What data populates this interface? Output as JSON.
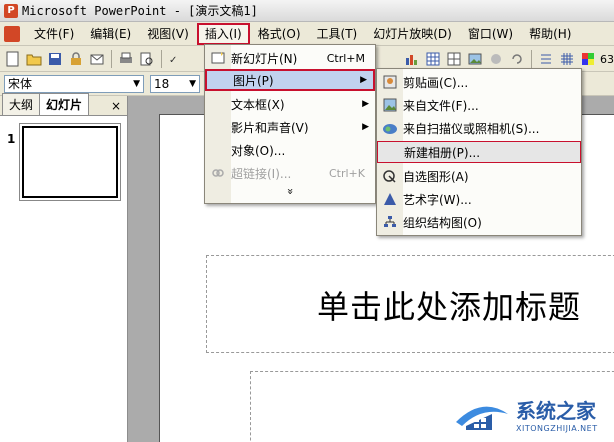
{
  "window": {
    "title": "Microsoft PowerPoint - [演示文稿1]"
  },
  "menubar": {
    "items": [
      {
        "label": "文件(F)"
      },
      {
        "label": "编辑(E)"
      },
      {
        "label": "视图(V)"
      },
      {
        "label": "插入(I)"
      },
      {
        "label": "格式(O)"
      },
      {
        "label": "工具(T)"
      },
      {
        "label": "幻灯片放映(D)"
      },
      {
        "label": "窗口(W)"
      },
      {
        "label": "帮助(H)"
      }
    ]
  },
  "toolbar": {
    "zoom_fragment": "63"
  },
  "formatbar": {
    "font": "宋体",
    "size": "18"
  },
  "left_pane": {
    "tabs": [
      {
        "label": "大纲"
      },
      {
        "label": "幻灯片"
      }
    ],
    "close": "×",
    "slide_number": "1"
  },
  "slide": {
    "title_placeholder": "单击此处添加标题"
  },
  "insert_menu": {
    "items": [
      {
        "label": "新幻灯片(N)",
        "shortcut": "Ctrl+M"
      },
      {
        "label": "图片(P)"
      },
      {
        "label": "文本框(X)"
      },
      {
        "label": "影片和声音(V)"
      },
      {
        "label": "对象(O)..."
      },
      {
        "label": "超链接(I)...",
        "shortcut": "Ctrl+K"
      }
    ],
    "more": "»"
  },
  "picture_menu": {
    "items": [
      {
        "label": "剪贴画(C)..."
      },
      {
        "label": "来自文件(F)..."
      },
      {
        "label": "来自扫描仪或照相机(S)..."
      },
      {
        "label": "新建相册(P)..."
      },
      {
        "label": "自选图形(A)"
      },
      {
        "label": "艺术字(W)..."
      },
      {
        "label": "组织结构图(O)"
      }
    ]
  },
  "watermark": {
    "name": "系统之家",
    "url": "XITONGZHIJIA.NET"
  },
  "colors": {
    "highlight_border": "#C8102E",
    "menu_highlight": "#C1D2EE",
    "chrome": "#ECE9D8"
  }
}
